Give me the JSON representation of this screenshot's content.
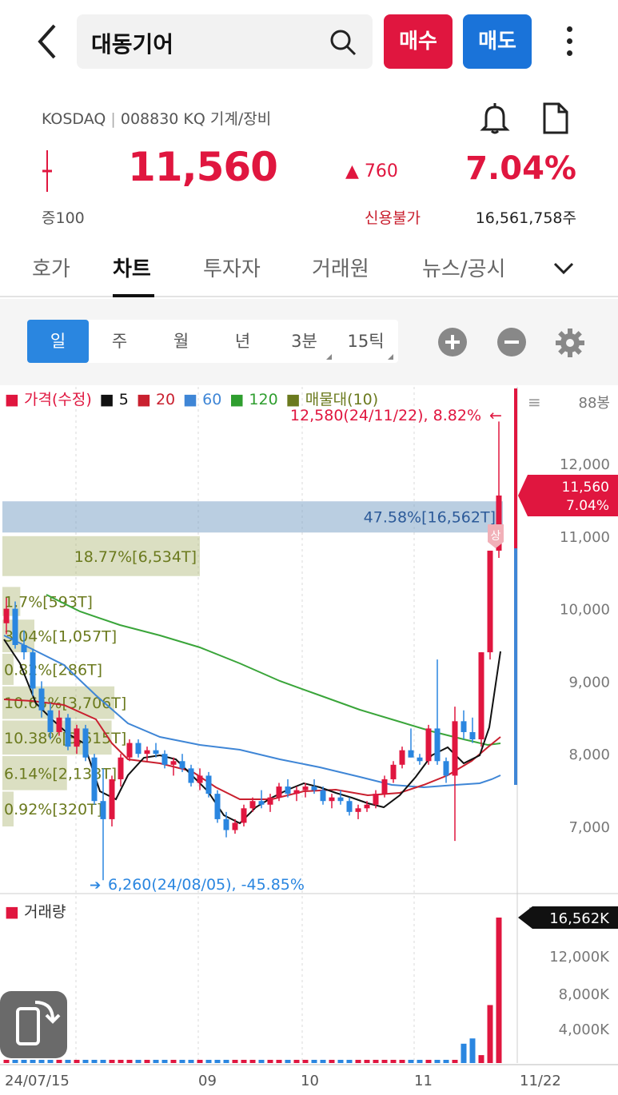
{
  "header": {
    "stock_name": "대동기어",
    "buy_label": "매수",
    "sell_label": "매도"
  },
  "info": {
    "market": "KOSDAQ",
    "code": "008830 KQ",
    "sector": "기계/장비",
    "price": "11,560",
    "change": "▲ 760",
    "change_pct": "7.04%",
    "lot": "증100",
    "credit": "신용불가",
    "shares": "16,561,758주"
  },
  "tabs": [
    "호가",
    "차트",
    "투자자",
    "거래원",
    "뉴스/공시"
  ],
  "periods": [
    "일",
    "주",
    "월",
    "년",
    "3분",
    "15틱"
  ],
  "colors": {
    "up": "#e0163f",
    "down": "#2a86e0",
    "ma5": "#111111",
    "ma20": "#c9202f",
    "ma60": "#3a7fd5",
    "ma120": "#2f9e2f",
    "profile": "#6b7a1e"
  },
  "legend": {
    "price": "가격(수정)",
    "ma5": "5",
    "ma20": "20",
    "ma60": "60",
    "ma120": "120",
    "profile": "매물대(10)"
  },
  "chart_data": {
    "type": "candlestick",
    "y_axis": {
      "ticks": [
        12000,
        11000,
        10000,
        9000,
        8000,
        7000
      ]
    },
    "x_axis": {
      "labels": [
        "24/07/15",
        "09",
        "10",
        "11",
        "11/22"
      ]
    },
    "high_annotation": "12,580(24/11/22), 8.82%",
    "low_annotation": "6,260(24/08/05), -45.85%",
    "current_tag": {
      "price": "11,560",
      "pct": "7.04%"
    },
    "period_label": "88봉",
    "upper_limit_badge": "상",
    "volume_profile": [
      {
        "label": "47.58%[16,562T]",
        "low": 11050,
        "high": 11480,
        "share": 47.58
      },
      {
        "label": "18.77%[6,534T]",
        "low": 10450,
        "high": 11000,
        "share": 18.77
      },
      {
        "label": "1.7%[593T]",
        "low": 9900,
        "high": 10300,
        "share": 1.7
      },
      {
        "label": "3.04%[1,057T]",
        "low": 9400,
        "high": 9850,
        "share": 3.04
      },
      {
        "label": "0.82%[286T]",
        "low": 8950,
        "high": 9380,
        "share": 0.82
      },
      {
        "label": "10.65%[3,706T]",
        "low": 8480,
        "high": 8930,
        "share": 10.65
      },
      {
        "label": "10.38%[3,615T]",
        "low": 7990,
        "high": 8460,
        "share": 10.38
      },
      {
        "label": "6.14%[2,138T]",
        "low": 7500,
        "high": 7970,
        "share": 6.14
      },
      {
        "label": "0.92%[320T]",
        "low": 7000,
        "high": 7480,
        "share": 0.92
      }
    ],
    "volume": {
      "label": "거래량",
      "current": "16,562K",
      "ticks": [
        "12,000K",
        "8,000K",
        "4,000K"
      ],
      "last_bars": [
        2200,
        2800,
        900,
        6600,
        16562
      ]
    }
  }
}
